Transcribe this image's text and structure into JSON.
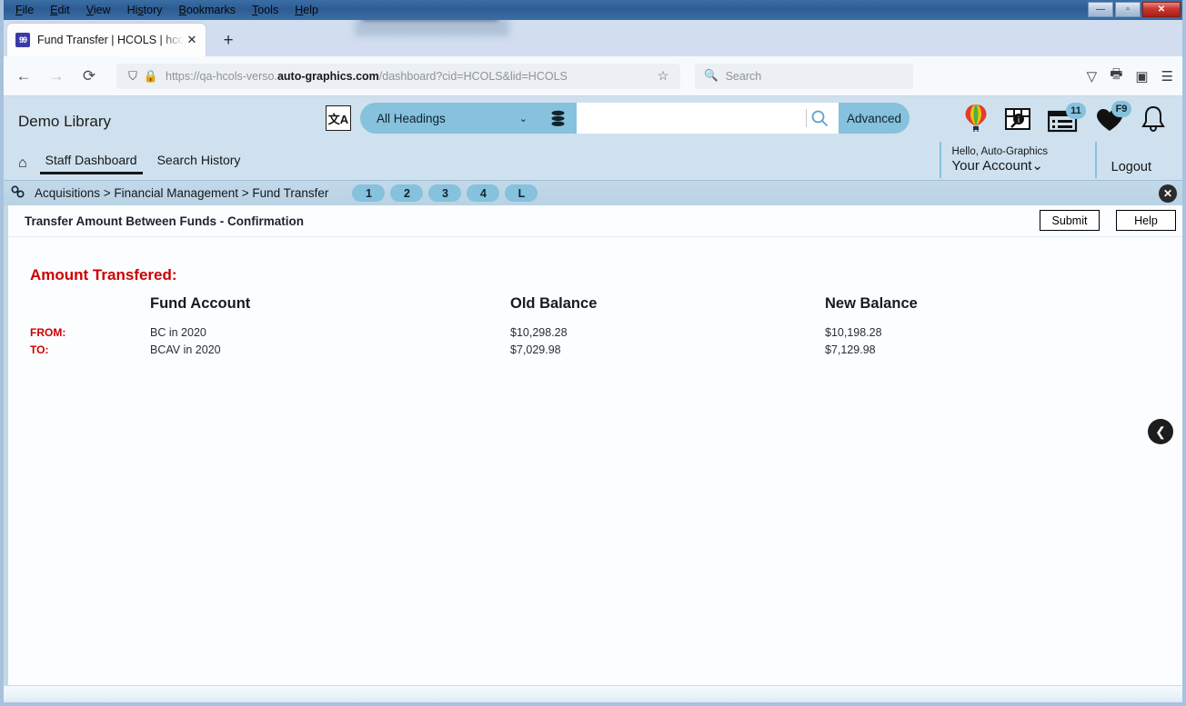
{
  "window": {
    "minimize_label": "—",
    "maximize_label": "▫",
    "close_label": "✕"
  },
  "menubar": {
    "items": [
      {
        "label": "File",
        "accel": "F"
      },
      {
        "label": "Edit",
        "accel": "E"
      },
      {
        "label": "View",
        "accel": "V"
      },
      {
        "label": "History",
        "accel": "s"
      },
      {
        "label": "Bookmarks",
        "accel": "B"
      },
      {
        "label": "Tools",
        "accel": "T"
      },
      {
        "label": "Help",
        "accel": "H"
      }
    ]
  },
  "browser": {
    "tab": {
      "favicon_text": "99",
      "title": "Fund Transfer | HCOLS | hcols | A",
      "close_label": "✕"
    },
    "new_tab_label": "+",
    "back_icon": "←",
    "forward_icon": "→",
    "reload_icon": "⟳",
    "shield_icon": "⛉",
    "lock_icon": "🔒",
    "url_prefix": "https://qa-hcols-verso.",
    "url_domain": "auto-graphics.com",
    "url_suffix": "/dashboard?cid=HCOLS&lid=HCOLS",
    "bookmark_star": "☆",
    "search_placeholder": "Search",
    "search_icon": "🔍",
    "pocket_icon": "▽",
    "print_icon": "🖶",
    "extension_icon": "▣",
    "menu_icon": "☰"
  },
  "app_header": {
    "brand": "Demo Library",
    "translate_icon_label": "文A",
    "scope_selected": "All Headings",
    "scope_chevron": "⌄",
    "database_icon": "▤",
    "search_value": "",
    "search_placeholder": "",
    "search_go_icon": "🔍",
    "advanced_label": "Advanced",
    "icons": [
      {
        "name": "balloon-icon",
        "glyph": "🎈",
        "badge": null
      },
      {
        "name": "map-search-icon",
        "glyph": "🗺",
        "badge": null
      },
      {
        "name": "lists-icon",
        "glyph": "📋",
        "badge": "11"
      },
      {
        "name": "favorites-icon",
        "glyph": "♥",
        "badge": "F9"
      },
      {
        "name": "notifications-icon",
        "glyph": "🔔",
        "badge": null
      }
    ]
  },
  "account_strip": {
    "home_icon": "⌂",
    "nav_links": [
      {
        "label": "Staff Dashboard",
        "active": true
      },
      {
        "label": "Search History",
        "active": false
      }
    ],
    "hello_text": "Hello, Auto-Graphics",
    "account_label": "Your Account",
    "account_chevron": "⌄",
    "logout_label": "Logout"
  },
  "breadcrumb": {
    "icon": "🔗",
    "text": "Acquisitions > Financial Management > Fund Transfer",
    "steps": [
      "1",
      "2",
      "3",
      "4",
      "L"
    ],
    "close_label": "✕"
  },
  "page": {
    "title": "Transfer Amount Between Funds - Confirmation",
    "submit_label": "Submit",
    "help_label": "Help",
    "back_fab_icon": "❮"
  },
  "content": {
    "heading": "Amount Transfered:",
    "columns": {
      "label": "",
      "fund_account": "Fund Account",
      "old_balance": "Old Balance",
      "new_balance": "New Balance"
    },
    "rows": [
      {
        "label": "FROM:",
        "fund_account": "BC in 2020",
        "old_balance": "$10,298.28",
        "new_balance": "$10,198.28"
      },
      {
        "label": "TO:",
        "fund_account": "BCAV in 2020",
        "old_balance": "$7,029.98",
        "new_balance": "$7,129.98"
      }
    ]
  },
  "colors": {
    "header_blue": "#cfe1ee",
    "accent_blue": "#86c1dd",
    "breadcrumb_blue": "#c3d9e8",
    "heading_red": "#cc0000",
    "titlebar_blue": "#2d5c93",
    "close_red": "#c9362d"
  }
}
